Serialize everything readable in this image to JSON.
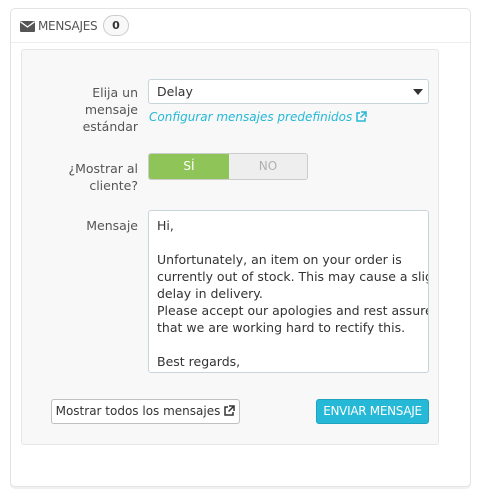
{
  "panel": {
    "title": "Mensajes",
    "count": "0",
    "icon": "envelope-icon"
  },
  "form": {
    "standard_message_label": "Elija un mensaje estándar",
    "standard_message_selected": "Delay",
    "configure_link": "Configurar mensajes predefinidos",
    "show_customer_label": "¿Mostrar al cliente?",
    "toggle_yes": "SÍ",
    "toggle_no": "NO",
    "toggle_selected": "SÍ",
    "message_label": "Mensaje",
    "message_lines": [
      "Hi,",
      "",
      "Unfortunately, an item on your order is",
      "currently out of stock. This may cause a slight",
      "delay in delivery.",
      "Please accept our apologies and rest assured",
      "that we are working hard to rectify this.",
      "",
      "Best regards,"
    ]
  },
  "actions": {
    "show_all_label": "Mostrar todos los mensajes",
    "send_label": "Enviar mensaje"
  },
  "colors": {
    "accent": "#25b9d7",
    "toggle_on": "#8fc558"
  }
}
